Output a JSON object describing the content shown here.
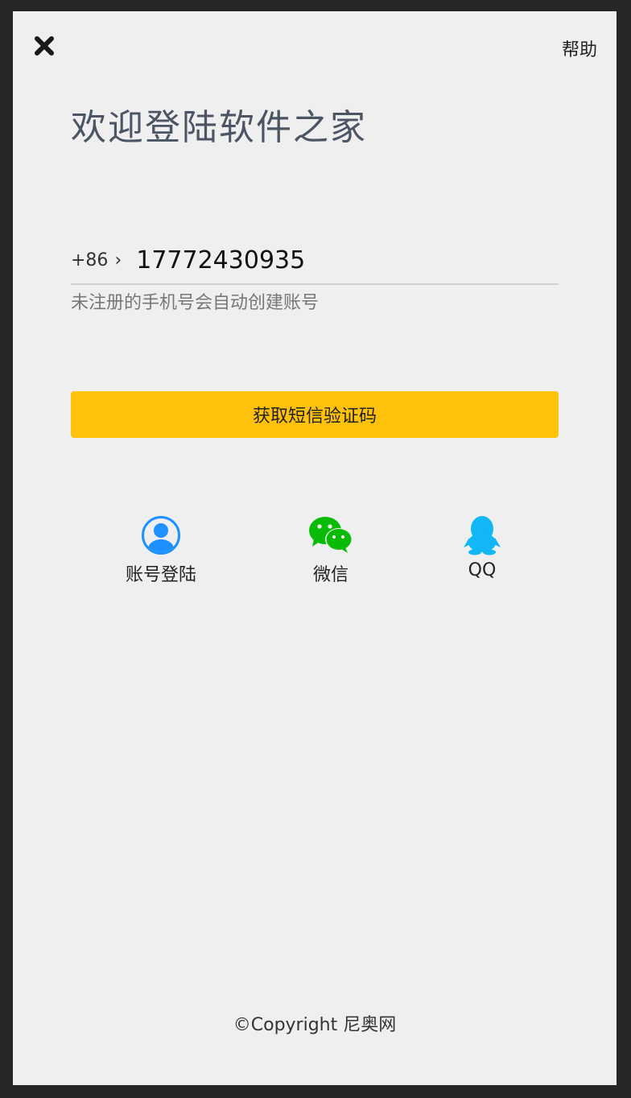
{
  "header": {
    "close_icon": "close-icon",
    "help_label": "帮助"
  },
  "welcome_title": "欢迎登陆软件之家",
  "phone": {
    "country_code": "+86",
    "value": "17772430935",
    "hint": "未注册的手机号会自动创建账号"
  },
  "sms_button_label": "获取短信验证码",
  "login_options": [
    {
      "label": "账号登陆",
      "icon": "user-account-icon",
      "color": "#1e90ff"
    },
    {
      "label": "微信",
      "icon": "wechat-icon",
      "color": "#09bb07"
    },
    {
      "label": "QQ",
      "icon": "qq-penguin-icon",
      "color": "#12b7f5"
    }
  ],
  "footer": {
    "copyright": "©Copyright 尼奥网"
  },
  "colors": {
    "primary_button": "#ffc20c",
    "screen_background": "#efefef",
    "frame": "#262626"
  }
}
